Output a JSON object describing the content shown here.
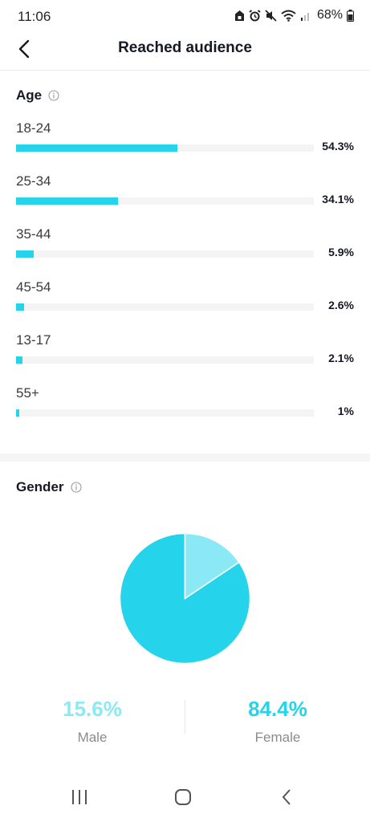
{
  "status_bar": {
    "time": "11:06",
    "battery": "68%"
  },
  "header": {
    "title": "Reached audience"
  },
  "age": {
    "title": "Age",
    "rows": [
      {
        "label": "18-24",
        "percent_text": "54.3%",
        "value": 54.3
      },
      {
        "label": "25-34",
        "percent_text": "34.1%",
        "value": 34.1
      },
      {
        "label": "35-44",
        "percent_text": "5.9%",
        "value": 5.9
      },
      {
        "label": "45-54",
        "percent_text": "2.6%",
        "value": 2.6
      },
      {
        "label": "13-17",
        "percent_text": "2.1%",
        "value": 2.1
      },
      {
        "label": "55+",
        "percent_text": "1%",
        "value": 1
      }
    ]
  },
  "gender": {
    "title": "Gender",
    "male": {
      "percent_text": "15.6%",
      "label": "Male",
      "value": 15.6,
      "color": "#8be9f6"
    },
    "female": {
      "percent_text": "84.4%",
      "label": "Female",
      "value": 84.4,
      "color": "#25d3ea"
    }
  },
  "colors": {
    "accent": "#25d3ea",
    "accent_light": "#8be9f6",
    "track": "#f4f4f5"
  },
  "icons": {
    "back": "back-arrow-icon",
    "info": "info-icon",
    "nav_recents": "recents-icon",
    "nav_home": "home-icon",
    "nav_back": "nav-back-icon"
  }
}
